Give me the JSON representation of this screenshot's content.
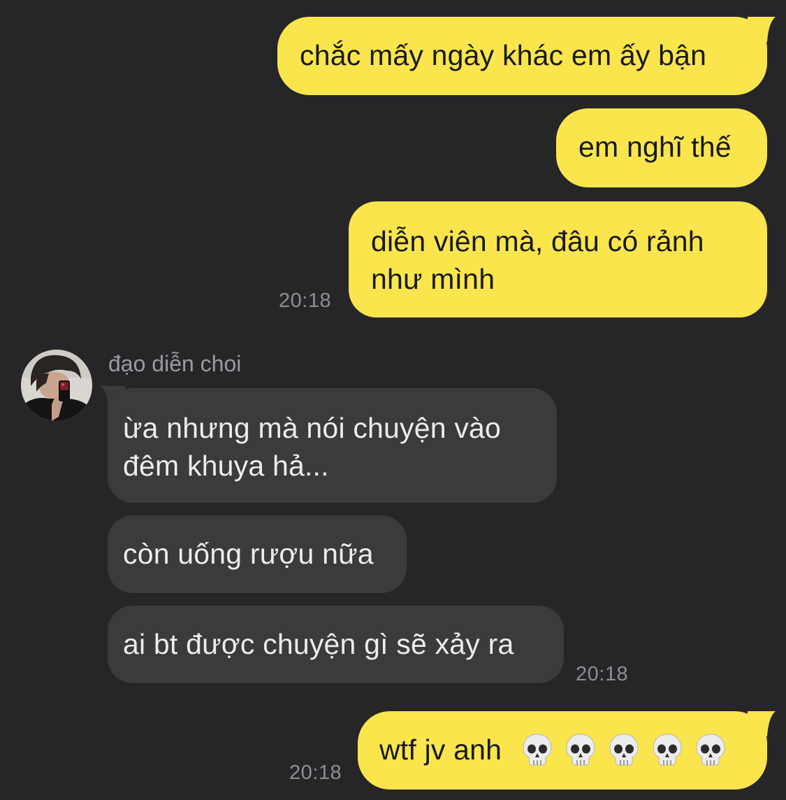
{
  "conversation": {
    "outgoing_1": {
      "msg1": "chắc mấy ngày khác em ấy bận",
      "msg2": "em nghĩ thế",
      "msg3_line1": "diễn viên mà, đâu có rảnh",
      "msg3_line2": "như mình",
      "time": "20:18"
    },
    "incoming": {
      "sender_name": "đạo diễn choi",
      "avatar_icon": "profile-photo",
      "msg1_line1": "ừa nhưng mà nói chuyện vào",
      "msg1_line2": "đêm khuya hả...",
      "msg2": "còn uống rượu nữa",
      "msg3": "ai bt được chuyện gì sẽ xảy ra",
      "time": "20:18"
    },
    "outgoing_2": {
      "msg_text": "wtf jv anh",
      "emoji": [
        "💀",
        "💀",
        "💀",
        "💀",
        "💀"
      ],
      "time": "20:18"
    }
  },
  "colors": {
    "background": "#262628",
    "outgoing_bubble": "#fae54d",
    "incoming_bubble": "#3b3b3d",
    "timestamp": "#8e8e92"
  }
}
